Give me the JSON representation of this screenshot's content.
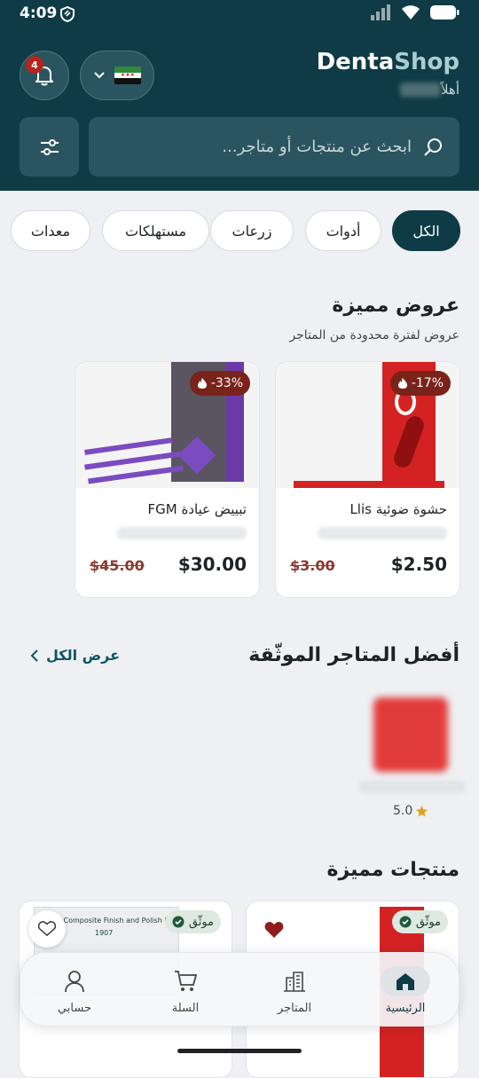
{
  "status_bar": {
    "time": "4:09"
  },
  "header": {
    "brand_part1": "Denta",
    "brand_part2": "Shop",
    "greeting": "أهلاً",
    "notifications_count": "4",
    "search_placeholder": "ابحث عن منتجات أو متاجر..."
  },
  "categories": [
    "الكل",
    "أدوات",
    "زرعات",
    "مستهلكات",
    "معدات"
  ],
  "deals": {
    "title": "عروض مميزة",
    "subtitle": "عروض لفترة محدودة من المتاجر",
    "items": [
      {
        "name": "حشوة ضوئية Llis",
        "discount": "-17%",
        "price": "$2.50",
        "old_price": "$3.00"
      },
      {
        "name": "تبييض عيادة FGM",
        "discount": "-33%",
        "price": "$30.00",
        "old_price": "$45.00"
      }
    ]
  },
  "stores": {
    "title": "أفضل المتاجر الموثّقة",
    "view_all": "عرض الكل",
    "items": [
      {
        "rating": "5.0"
      }
    ]
  },
  "featured": {
    "title": "منتجات مميزة",
    "items": [
      {
        "badge": "موثّق",
        "image_text_1": "ST Composite Finish and Polish Kit",
        "image_text_2": "1907"
      },
      {
        "badge": "موثّق"
      }
    ]
  },
  "bottom_nav": [
    {
      "label": "الرئيسية",
      "icon": "home-icon"
    },
    {
      "label": "المتاجر",
      "icon": "stores-icon"
    },
    {
      "label": "السلة",
      "icon": "cart-icon"
    },
    {
      "label": "حسابي",
      "icon": "person-icon"
    }
  ],
  "colors": {
    "primary": "#0e3b46",
    "discount": "#7a231b",
    "verified_bg": "#dde9e1"
  }
}
